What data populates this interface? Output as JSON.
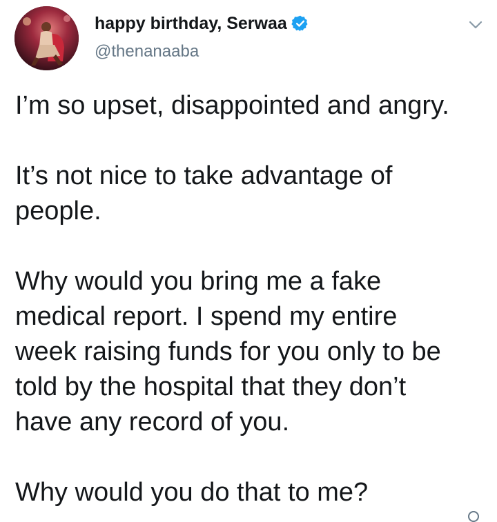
{
  "tweet": {
    "author": {
      "display_name": "happy birthday, Serwaa",
      "handle": "@thenanaaba",
      "verified": true,
      "avatar_icon": "profile-photo",
      "verified_icon": "verified-badge-icon"
    },
    "menu_icon": "chevron-down-icon",
    "paragraphs": [
      "I’m so upset, disappointed and angry.",
      "It’s not nice to take advantage of\npeople.",
      "Why would you bring me a fake\nmedical report. I spend my entire\nweek raising funds for you only to be\ntold by the hospital that they don’t\nhave any record of you.",
      "Why would you do that to me?"
    ]
  },
  "colors": {
    "text": "#14171a",
    "secondary_text": "#657786",
    "verified_blue": "#1da1f2",
    "background": "#ffffff"
  }
}
